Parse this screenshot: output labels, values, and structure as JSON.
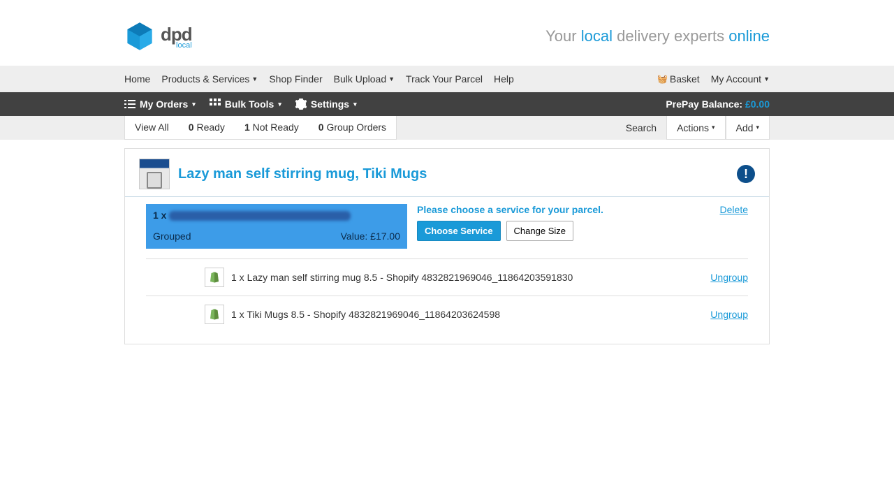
{
  "header": {
    "brand_main": "dpd",
    "brand_sub": "local",
    "tagline_p1": "Your ",
    "tagline_p2": "local",
    "tagline_p3": " delivery experts ",
    "tagline_p4": "online"
  },
  "nav": {
    "home": "Home",
    "products": "Products & Services",
    "shop_finder": "Shop Finder",
    "bulk_upload": "Bulk Upload",
    "track": "Track Your Parcel",
    "help": "Help",
    "basket": "Basket",
    "account": "My Account"
  },
  "darkbar": {
    "my_orders": "My Orders",
    "bulk_tools": "Bulk Tools",
    "settings": "Settings",
    "balance_label": "PrePay Balance: ",
    "balance_value": "£0.00"
  },
  "filters": {
    "view_all": "View All",
    "ready_count": "0",
    "ready_label": " Ready",
    "not_ready_count": "1",
    "not_ready_label": " Not Ready",
    "group_count": "0",
    "group_label": " Group Orders",
    "search": "Search",
    "actions": "Actions",
    "add": "Add"
  },
  "order": {
    "title": "Lazy man self stirring mug, Tiki Mugs",
    "qty_prefix": "1 x",
    "grouped": "Grouped",
    "value_label": "Value: £17.00",
    "prompt": "Please choose a service for your parcel.",
    "choose_service": "Choose Service",
    "change_size": "Change Size",
    "delete": "Delete",
    "items": [
      {
        "text": "1 x Lazy man self stirring mug 8.5 - Shopify 4832821969046_11864203591830",
        "ungroup": "Ungroup"
      },
      {
        "text": "1 x Tiki Mugs 8.5 - Shopify 4832821969046_11864203624598",
        "ungroup": "Ungroup"
      }
    ]
  }
}
